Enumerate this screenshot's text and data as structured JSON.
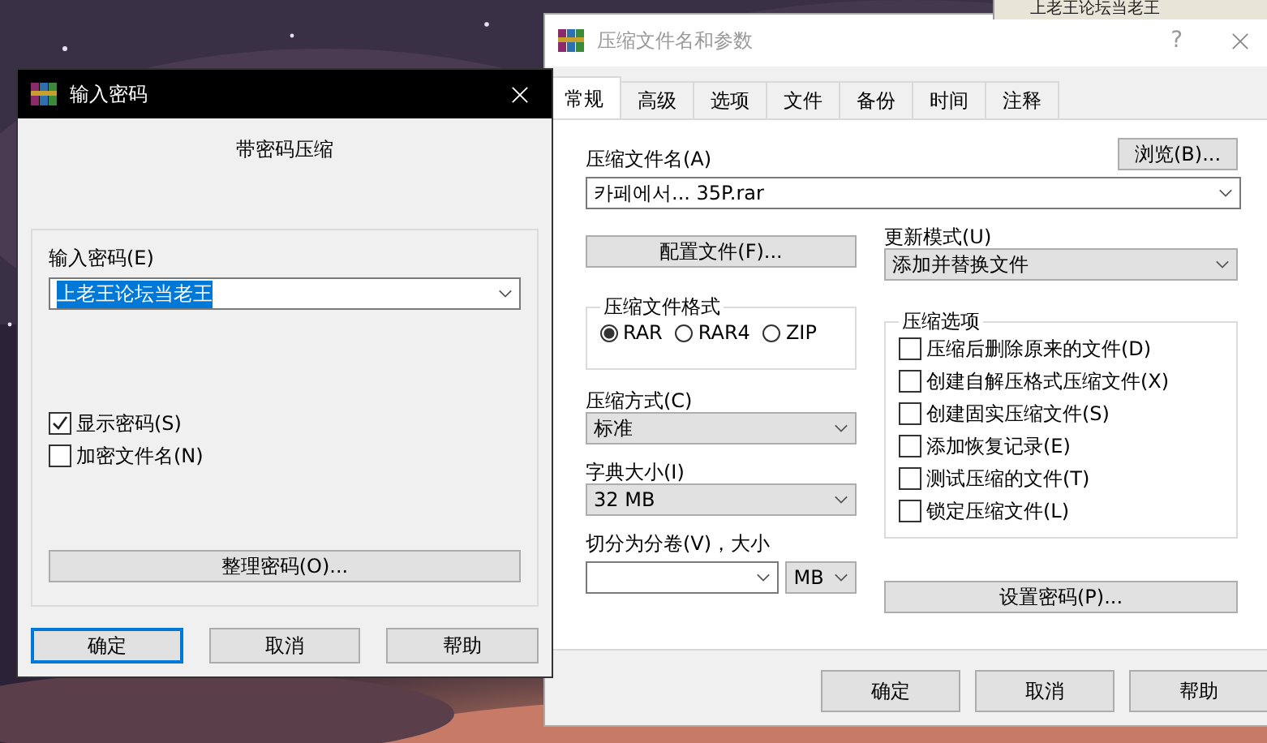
{
  "background_window": {
    "title": "上老王论坛当老王"
  },
  "password_dialog": {
    "title": "输入密码",
    "active": true,
    "heading": "带密码压缩",
    "password_label": "输入密码(E)",
    "password_value": "上老王论坛当老王",
    "value_selected": true,
    "options": [
      {
        "label": "显示密码(S)",
        "checked": true
      },
      {
        "label": "加密文件名(N)",
        "checked": false
      }
    ],
    "manage_button": "整理密码(O)...",
    "buttons": [
      {
        "label": "确定",
        "default": true
      },
      {
        "label": "取消",
        "default": false
      },
      {
        "label": "帮助",
        "default": false
      }
    ]
  },
  "archive_dialog": {
    "title": "压缩文件名和参数",
    "active": false,
    "help": "?",
    "tabs": [
      {
        "label": "常规",
        "selected": true
      },
      {
        "label": "高级",
        "selected": false
      },
      {
        "label": "选项",
        "selected": false
      },
      {
        "label": "文件",
        "selected": false
      },
      {
        "label": "备份",
        "selected": false
      },
      {
        "label": "时间",
        "selected": false
      },
      {
        "label": "注释",
        "selected": false
      }
    ],
    "archive_name_label": "压缩文件名(A)",
    "browse_button": "浏览(B)...",
    "archive_name": "카페에서... 35P.rar",
    "profiles_button": "配置文件(F)...",
    "update_mode_label": "更新模式(U)",
    "update_mode": "添加并替换文件",
    "format_group": "压缩文件格式",
    "formats": [
      {
        "label": "RAR",
        "selected": true
      },
      {
        "label": "RAR4",
        "selected": false
      },
      {
        "label": "ZIP",
        "selected": false
      }
    ],
    "method_label": "压缩方式(C)",
    "method": "标准",
    "dictionary_label": "字典大小(I)",
    "dictionary": "32 MB",
    "split_label": "切分为分卷(V)，大小",
    "split_unit": "MB",
    "options_group": "压缩选项",
    "options": [
      {
        "label": "压缩后删除原来的文件(D)",
        "checked": false
      },
      {
        "label": "创建自解压格式压缩文件(X)",
        "checked": false
      },
      {
        "label": "创建固实压缩文件(S)",
        "checked": false
      },
      {
        "label": "添加恢复记录(E)",
        "checked": false
      },
      {
        "label": "测试压缩的文件(T)",
        "checked": false
      },
      {
        "label": "锁定压缩文件(L)",
        "checked": false
      }
    ],
    "set_password_button": "设置密码(P)...",
    "buttons": [
      {
        "label": "确定",
        "default": false
      },
      {
        "label": "取消",
        "default": false
      },
      {
        "label": "帮助",
        "default": false
      }
    ]
  }
}
